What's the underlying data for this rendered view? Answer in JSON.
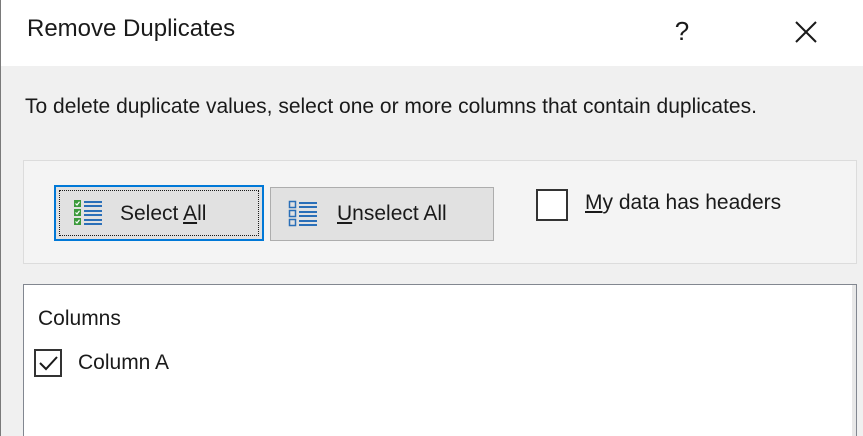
{
  "window": {
    "title": "Remove Duplicates",
    "help_label": "?"
  },
  "instructions": "To delete duplicate values, select one or more columns that contain duplicates.",
  "buttons": {
    "select_all": {
      "pre": "Select ",
      "accel": "A",
      "post": "ll",
      "icon": "select-all-list-icon"
    },
    "unselect_all": {
      "pre": "",
      "accel": "U",
      "post": "nselect All",
      "icon": "unselect-all-list-icon"
    }
  },
  "headers_checkbox": {
    "pre": "",
    "accel": "M",
    "post": "y data has headers",
    "checked": false
  },
  "columns": {
    "header": "Columns",
    "items": [
      {
        "label": "Column A",
        "checked": true
      }
    ]
  },
  "colors": {
    "focus_border": "#0078d7",
    "button_face": "#e1e1e1",
    "dialog_bg": "#f0f0f0",
    "icon_green": "#3c9a3c",
    "icon_blue": "#2a6fb8"
  }
}
